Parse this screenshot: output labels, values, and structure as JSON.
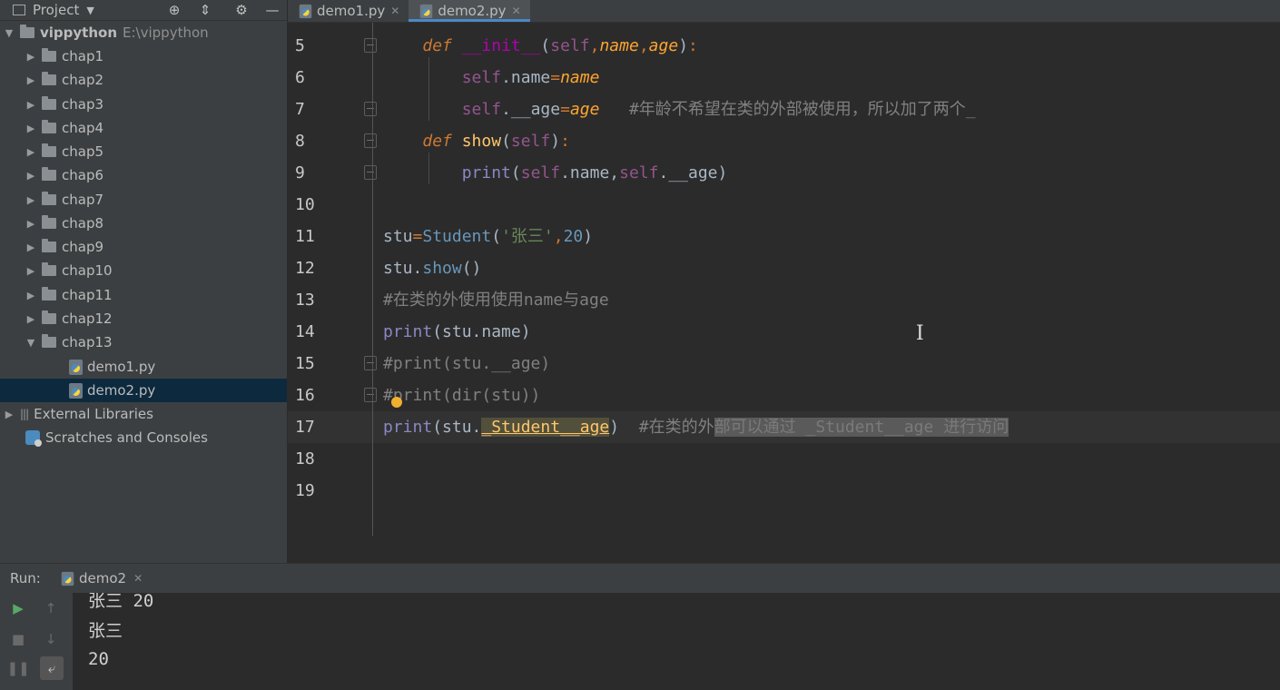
{
  "project_panel": {
    "title": "Project",
    "root": {
      "name": "vippython",
      "path": "E:\\vippython"
    },
    "folders": [
      "chap1",
      "chap2",
      "chap3",
      "chap4",
      "chap5",
      "chap6",
      "chap7",
      "chap8",
      "chap9",
      "chap10",
      "chap11",
      "chap12",
      "chap13"
    ],
    "files": [
      "demo1.py",
      "demo2.py"
    ],
    "external_libraries": "External Libraries",
    "scratches": "Scratches and Consoles"
  },
  "tabs": [
    {
      "label": "demo1.py",
      "active": false
    },
    {
      "label": "demo2.py",
      "active": true
    }
  ],
  "editor": {
    "line_numbers": [
      "5",
      "6",
      "7",
      "8",
      "9",
      "10",
      "11",
      "12",
      "13",
      "14",
      "15",
      "16",
      "17",
      "18",
      "19"
    ],
    "current_line": "17",
    "code": {
      "l5": {
        "def": "def",
        "name": "__init__",
        "p1": "(",
        "self": "self",
        "c1": ",",
        "name_p": "name",
        "c2": ",",
        "age_p": "age",
        "p2": ")",
        "colon": ":"
      },
      "l6": {
        "self": "self",
        "attr": ".name",
        "eq": "=",
        "val": "name"
      },
      "l7": {
        "self": "self",
        "attr": ".__age",
        "eq": "=",
        "val": "age",
        "comment": "#年龄不希望在类的外部被使用，所以加了两个_"
      },
      "l8": {
        "def": "def",
        "name": "show",
        "p1": "(",
        "self": "self",
        "p2": ")",
        "colon": ":"
      },
      "l9": {
        "fn": "print",
        "p1": "(",
        "self1": "self",
        "a1": ".name,",
        "self2": "self",
        "a2": ".__age)"
      },
      "l11": {
        "var": "stu",
        "eq": "=",
        "cls": "Student",
        "p1": "(",
        "str": "'张三'",
        "c": ",",
        "num": "20",
        "p2": ")"
      },
      "l12": {
        "var": "stu.",
        "call": "show",
        "rest": "()"
      },
      "l13": {
        "comment": "#在类的外使用使用name与age"
      },
      "l14": {
        "fn": "print",
        "rest": "(stu.name)"
      },
      "l15": {
        "comment": "#print(stu.__age)"
      },
      "l16": {
        "comment": "#print(dir(stu))"
      },
      "l17": {
        "fn": "print",
        "pre": "(stu.",
        "attr": "_Student__age",
        "post": ")",
        "comment_a": "#在类的外",
        "comment_b": "部可以通过 _Student__age 进行访问"
      }
    }
  },
  "run_panel": {
    "label": "Run:",
    "tab": "demo2",
    "output": [
      "张三 20",
      "张三",
      "20"
    ]
  },
  "colors": {
    "accent": "#4a88c7",
    "keyword": "#cc7832",
    "function": "#ffc66d",
    "self": "#94558d",
    "number": "#6897bb",
    "comment": "#808080"
  }
}
